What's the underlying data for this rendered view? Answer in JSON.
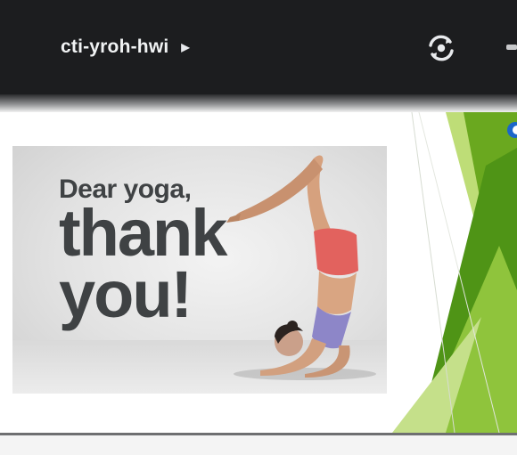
{
  "topbar": {
    "meeting_code": "cti-yroh-hwi",
    "caret_icon": "caret-right-icon",
    "refresh_icon": "refresh-camera-icon"
  },
  "slide": {
    "image_text": {
      "line1": "Dear yoga,",
      "line2": "thank",
      "line3": "you!"
    },
    "colors": {
      "green_dark": "#5ea31a",
      "green_light": "#a7d04a",
      "text_gray": "#3f4244",
      "bar_dark": "#1c1d1f"
    }
  }
}
